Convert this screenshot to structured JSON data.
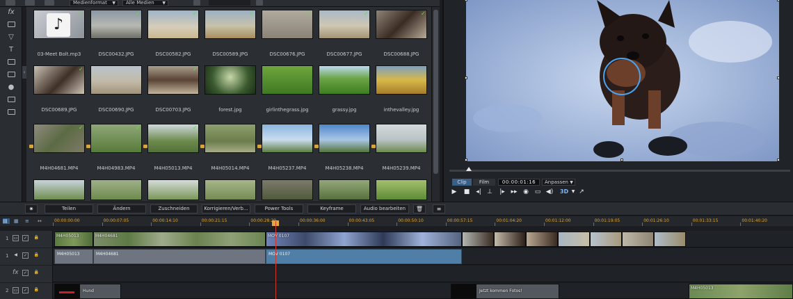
{
  "toolbar": {
    "format_filter": "Medienformat",
    "media_filter": "Alle Medien"
  },
  "media_items": [
    {
      "name": "03-Meet Bolt.mp3",
      "kind": "audio",
      "checked": true
    },
    {
      "name": "DSC00432.JPG",
      "kind": "image",
      "checked": true
    },
    {
      "name": "DSC00582.JPG",
      "kind": "image",
      "checked": true
    },
    {
      "name": "DSC00589.JPG",
      "kind": "image",
      "checked": true
    },
    {
      "name": "DSC00676.JPG",
      "kind": "image",
      "checked": true
    },
    {
      "name": "DSC00677.JPG",
      "kind": "image",
      "checked": true
    },
    {
      "name": "DSC00688.JPG",
      "kind": "image",
      "checked": true
    },
    {
      "name": "DSC00689.JPG",
      "kind": "image",
      "checked": true
    },
    {
      "name": "DSC00690.JPG",
      "kind": "image",
      "checked": false
    },
    {
      "name": "DSC00703.JPG",
      "kind": "image",
      "checked": true
    },
    {
      "name": "forest.jpg",
      "kind": "image",
      "checked": false
    },
    {
      "name": "girlinthegrass.jpg",
      "kind": "image",
      "checked": false
    },
    {
      "name": "grassy.jpg",
      "kind": "image",
      "checked": false
    },
    {
      "name": "inthevalley.jpg",
      "kind": "image",
      "checked": false
    },
    {
      "name": "M4H04681.MP4",
      "kind": "video",
      "checked": true
    },
    {
      "name": "M4H04983.MP4",
      "kind": "video",
      "checked": true
    },
    {
      "name": "M4H05013.MP4",
      "kind": "video",
      "checked": true
    },
    {
      "name": "M4H05014.MP4",
      "kind": "video",
      "checked": false
    },
    {
      "name": "M4H05237.MP4",
      "kind": "video",
      "checked": false
    },
    {
      "name": "M4H05238.MP4",
      "kind": "video",
      "checked": false
    },
    {
      "name": "M4H05239.MP4",
      "kind": "video",
      "checked": false
    }
  ],
  "preview": {
    "tab_clip": "Clip",
    "tab_film": "Film",
    "timecode": "00:00:01:16",
    "fit_label": "Anpassen",
    "three_d": "3D"
  },
  "edit_toolbar": {
    "split": "Teilen",
    "modify": "Ändern",
    "trim": "Zuschneiden",
    "correct": "Korrigieren/Verb...",
    "power_tools": "Power Tools",
    "keyframe": "Keyframe",
    "audio_edit": "Audio bearbeiten"
  },
  "ruler_ticks": [
    "00:00:00:00",
    "00:00:07:05",
    "00:00:14:10",
    "00:00:21:15",
    "00:00:28:20",
    "00:00:36:00",
    "00:00:43:05",
    "00:00:50:10",
    "00:00:57:15",
    "00:01:04:20",
    "00:01:12:00",
    "00:01:19:05",
    "00:01:26:10",
    "00:01:33:15",
    "00:01:40:20"
  ],
  "tracks": {
    "video1": {
      "number": "1",
      "clips": [
        "M4H05013",
        "M4H04681",
        "MOV 0107"
      ]
    },
    "audio1": {
      "number": "1",
      "clips": [
        "M4H05013",
        "M4H04681",
        "MOV 0107"
      ]
    },
    "text_track": {
      "label": "fx"
    },
    "video2": {
      "number": "2",
      "clips": [
        "Hund",
        "Jetzt kommen Fotos!",
        "M4H05013"
      ]
    }
  },
  "colors": {
    "accent": "#3b5e86",
    "check": "#59e04a",
    "timecode_ruler": "#e0a838",
    "playhead": "#d13a2a",
    "audio_clip": "#4f7ea6"
  }
}
